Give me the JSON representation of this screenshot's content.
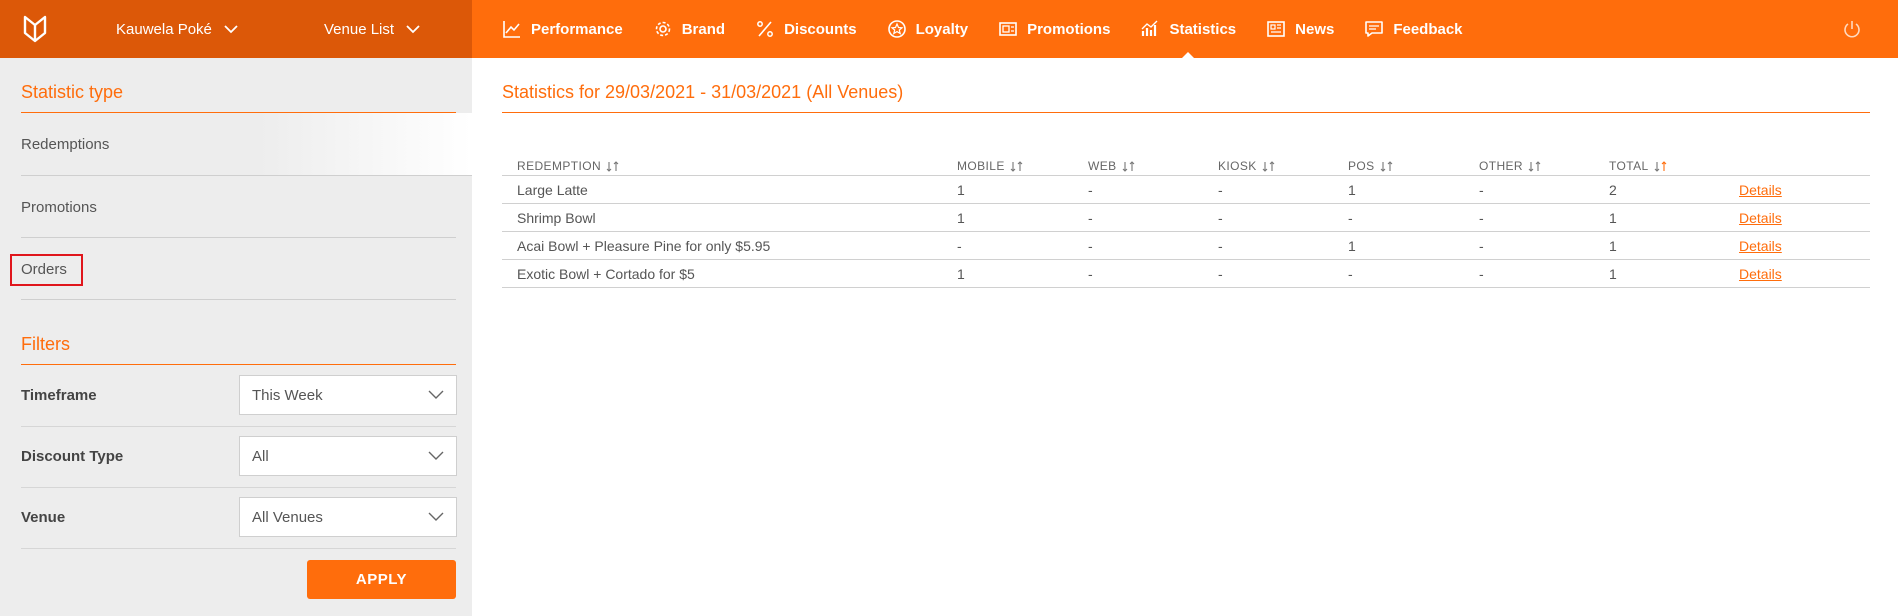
{
  "brand": {
    "logo_icon": "monogram-logo-icon",
    "selected_brand": "Kauwela Poké",
    "venue_list_label": "Venue List"
  },
  "nav": [
    {
      "label": "Performance",
      "icon": "chart-line-icon"
    },
    {
      "label": "Brand",
      "icon": "gear-icon"
    },
    {
      "label": "Discounts",
      "icon": "percent-icon"
    },
    {
      "label": "Loyalty",
      "icon": "star-circle-icon"
    },
    {
      "label": "Promotions",
      "icon": "promotion-card-icon"
    },
    {
      "label": "Statistics",
      "icon": "bar-chart-icon",
      "active": true
    },
    {
      "label": "News",
      "icon": "newspaper-icon"
    },
    {
      "label": "Feedback",
      "icon": "chat-bubble-icon"
    }
  ],
  "sidebar": {
    "statistic_type_title": "Statistic type",
    "statistic_types": [
      "Redemptions",
      "Promotions",
      "Orders"
    ],
    "filters_title": "Filters",
    "filters": [
      {
        "label": "Timeframe",
        "value": "This Week"
      },
      {
        "label": "Discount Type",
        "value": "All"
      },
      {
        "label": "Venue",
        "value": "All Venues"
      }
    ],
    "apply_label": "APPLY"
  },
  "main": {
    "title": "Statistics for 29/03/2021 - 31/03/2021 (All Venues)",
    "columns": [
      "REDEMPTION",
      "MOBILE",
      "WEB",
      "KIOSK",
      "POS",
      "OTHER",
      "TOTAL"
    ],
    "rows": [
      [
        "Large Latte",
        "1",
        "-",
        "-",
        "1",
        "-",
        "2",
        "Details"
      ],
      [
        "Shrimp Bowl",
        "1",
        "-",
        "-",
        "-",
        "-",
        "1",
        "Details"
      ],
      [
        "Acai Bowl + Pleasure Pine for only $5.95",
        "-",
        "-",
        "-",
        "1",
        "-",
        "1",
        "Details"
      ],
      [
        "Exotic Bowl + Cortado for $5",
        "1",
        "-",
        "-",
        "-",
        "-",
        "1",
        "Details"
      ]
    ]
  },
  "colors": {
    "accent": "#ff6d0c",
    "header_left": "#dc5808",
    "sidebar_bg": "#ededed",
    "highlight_box": "#e0161c"
  }
}
